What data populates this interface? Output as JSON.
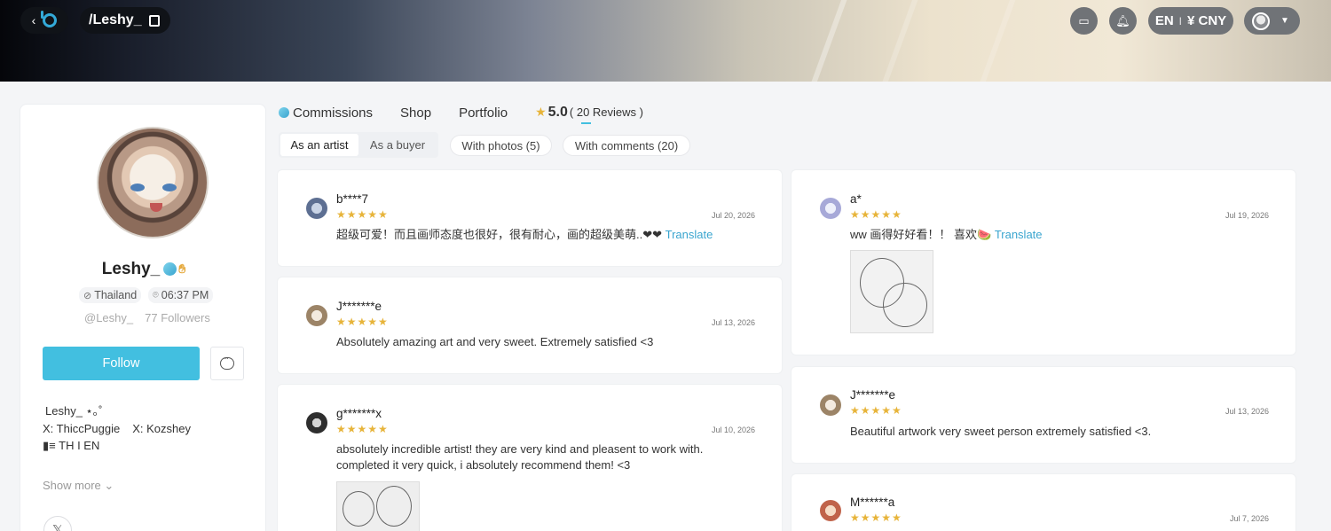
{
  "topbar": {
    "handle": "/Leshy_",
    "lang_currency": "EN",
    "currency": "¥ CNY",
    "separator": "I"
  },
  "profile": {
    "name": "Leshy_",
    "country": "Thailand",
    "local_time": "06:37 PM",
    "at_handle": "@Leshy_",
    "followers": "77 Followers",
    "follow_label": "Follow",
    "bio_line1": "Leshy_ ⋆｡˚",
    "bio_x1": "X: ThiccPuggie",
    "bio_x2": "X: Kozshey",
    "bio_lang": "TH I EN",
    "show_more": "Show more"
  },
  "tabs": {
    "commissions": "Commissions",
    "shop": "Shop",
    "portfolio": "Portfolio",
    "score": "5.0",
    "reviews": "( 20 Reviews )"
  },
  "filters": {
    "as_artist": "As an artist",
    "as_buyer": "As a buyer",
    "with_photos": "With photos (5)",
    "with_comments": "With comments (20)"
  },
  "reviews_left": [
    {
      "name": "b****7",
      "date": "Jul 20, 2026",
      "stars": "★★★★★",
      "text": "超级可爱！而且画师态度也很好，很有耐心，画的超级美萌..❤❤ ",
      "translate": "Translate"
    },
    {
      "name": "J*******e",
      "date": "Jul 13, 2026",
      "stars": "★★★★★",
      "text": "Absolutely amazing art and very sweet.  Extremely satisfied <3"
    },
    {
      "name": "g*******x",
      "date": "Jul 10, 2026",
      "stars": "★★★★★",
      "text": "absolutely incredible artist! they are very kind and pleasent to work with.",
      "text2": "completed it very quick, i absolutely recommend them! <3"
    }
  ],
  "reviews_right": [
    {
      "name": "a*",
      "date": "Jul 19, 2026",
      "stars": "★★★★★",
      "text": "ww 画得好好看！！ 喜欢🍉 ",
      "translate": "Translate"
    },
    {
      "name": "J*******e",
      "date": "Jul 13, 2026",
      "stars": "★★★★★",
      "text": "Beautiful artwork very sweet person extremely satisfied <3."
    },
    {
      "name": "M******a",
      "date": "Jul 7, 2026",
      "stars": "★★★★★"
    }
  ],
  "colors": {
    "accent": "#42bfe0",
    "star": "#e7b43a",
    "translate": "#3aa5cf"
  }
}
